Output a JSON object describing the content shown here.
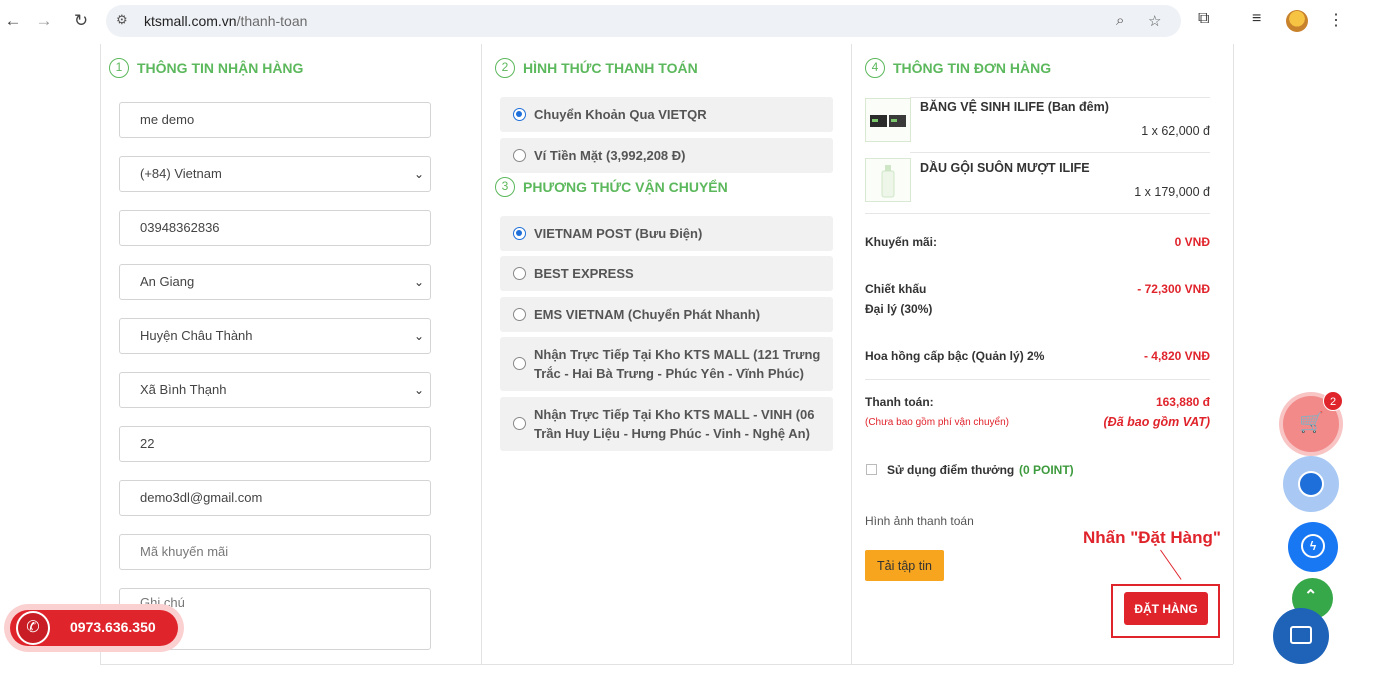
{
  "browser": {
    "url_host": "ktsmall.com.vn",
    "url_path": "/thanh-toan"
  },
  "sections": {
    "shipping_info": {
      "num": "1",
      "title": "THÔNG TIN NHẬN HÀNG"
    },
    "payment_method": {
      "num": "2",
      "title": "HÌNH THỨC THANH TOÁN"
    },
    "shipping_method": {
      "num": "3",
      "title": "PHƯƠNG THỨC VẬN CHUYỂN"
    },
    "order_info": {
      "num": "4",
      "title": "THÔNG TIN ĐƠN HÀNG"
    }
  },
  "form": {
    "name": "me demo",
    "country": "(+84) Vietnam",
    "phone": "03948362836",
    "province": "An Giang",
    "district": "Huyện Châu Thành",
    "ward": "Xã Bình Thạnh",
    "address": "22",
    "email": "demo3dl@gmail.com",
    "promo_placeholder": "Mã khuyến mãi",
    "note_placeholder": "Ghi chú"
  },
  "payment_options": [
    {
      "label": "Chuyển Khoản Qua VIETQR",
      "selected": true
    },
    {
      "label": "Ví Tiền Mặt (3,992,208 Đ)",
      "selected": false
    }
  ],
  "shipping_options": [
    {
      "label": "VIETNAM POST (Bưu Điện)",
      "selected": true
    },
    {
      "label": "BEST EXPRESS",
      "selected": false
    },
    {
      "label": "EMS VIETNAM (Chuyển Phát Nhanh)",
      "selected": false
    },
    {
      "label_line1": "Nhận Trực Tiếp Tại Kho KTS MALL (121 Trưng",
      "label_line2": "Trắc - Hai Bà Trưng - Phúc Yên - Vĩnh Phúc)",
      "selected": false
    },
    {
      "label_line1": "Nhận Trực Tiếp Tại Kho KTS MALL - VINH (06",
      "label_line2": "Trần Huy Liệu - Hưng Phúc - Vinh - Nghệ An)",
      "selected": false
    }
  ],
  "order": {
    "items": [
      {
        "name": "BĂNG VỆ SINH ILIFE (Ban đêm)",
        "qty": "1 x 62,000 đ"
      },
      {
        "name": "DẦU GỘI SUÔN MƯỢT ILIFE",
        "qty": "1 x 179,000 đ"
      }
    ],
    "promo_label": "Khuyến mãi:",
    "promo_value": "0 VNĐ",
    "discount_label_1": "Chiết khấu",
    "discount_label_2": "Đại lý (30%)",
    "discount_value": "- 72,300  VNĐ",
    "commission_label": "Hoa hồng cấp bậc (Quản lý) 2%",
    "commission_value": "- 4,820  VNĐ",
    "total_label": "Thanh toán:",
    "total_value": "163,880 đ",
    "shipping_note": "(Chưa bao gồm phí vận chuyển)",
    "vat_note": "(Đã bao gồm VAT)",
    "points_label": "Sử dụng điểm thưởng",
    "points_value": "(0 POINT)",
    "payment_image_label": "Hình ảnh thanh toán",
    "upload_label": "Tải tập tin",
    "place_order_label": "ĐẶT HÀNG"
  },
  "annotation": "Nhấn \"Đặt Hàng\"",
  "cart_badge": "2",
  "hotline": "0973.636.350"
}
